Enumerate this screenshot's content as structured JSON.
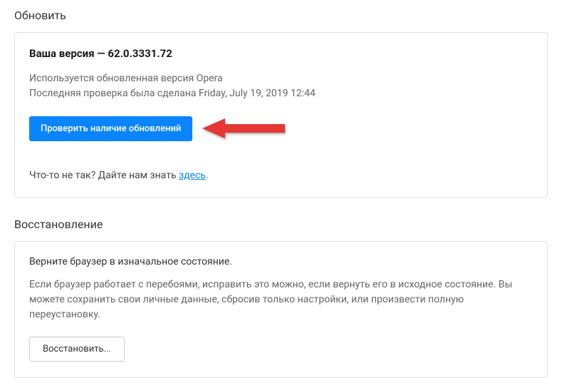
{
  "update": {
    "section_title": "Обновить",
    "version_label": "Ваша версия — 62.0.3331.72",
    "status_line": "Используется обновленная версия Opera",
    "last_check_line": "Последняя проверка была сделана Friday, July 19, 2019 12:44",
    "check_button": "Проверить наличие обновлений",
    "feedback_prefix": "Что-то не так? Дайте нам знать ",
    "feedback_link": "здесь",
    "feedback_suffix": "."
  },
  "restore": {
    "section_title": "Восстановление",
    "intro": "Верните браузер в изначальное состояние.",
    "description": "Если браузер работает с перебоями, исправить это можно, если вернуть его в исходное состояние. Вы можете сохранить свои личные данные, сбросив только настройки, или произвести полную переустановку.",
    "button": "Восстановить..."
  },
  "colors": {
    "primary": "#0a84ff",
    "arrow": "#e53935"
  }
}
